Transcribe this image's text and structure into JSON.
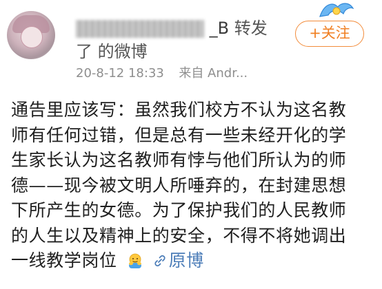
{
  "post": {
    "author": {
      "name_tail": "_B",
      "action": "转发",
      "suffix_line2": "了 的微博"
    },
    "meta": {
      "time": "20-8-12 18:33",
      "source": "来自 Andr..."
    },
    "follow_label": "+关注",
    "content": {
      "line1": "通告里应该写：虽然我们校方不认为这名教",
      "line2": "师有任何过错，但是总有一些未经开化的学",
      "line3": "生家长认为这名教师有悖与他们所认为的师",
      "line4": "德——现今被文明人所唾弃的，在封建思想",
      "line5": "下所产生的女德。为了保护我们的人民教师",
      "line6": "的人生以及精神上的安全，不得不将她调出",
      "line7": "一线教学岗位",
      "original_link": "原博"
    },
    "icons": {
      "emoji": "hugging-emoji-icon",
      "link": "link-icon",
      "badge": "membership-badge-icon"
    },
    "colors": {
      "accent": "#f07f22",
      "link": "#4c7db8",
      "meta": "#8e8e8e"
    }
  }
}
